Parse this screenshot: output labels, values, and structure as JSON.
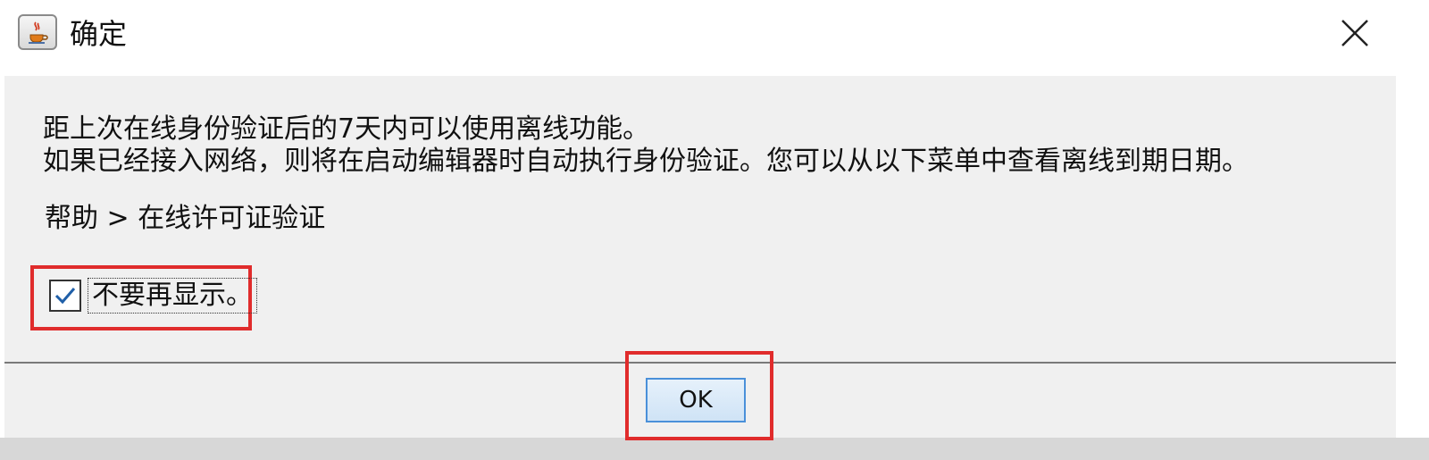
{
  "window": {
    "title": "确定",
    "icon": "java-cup-icon",
    "close_icon": "close-icon"
  },
  "message": {
    "line1": "距上次在线身份验证后的7天内可以使用离线功能。",
    "line2": "如果已经接入网络，则将在启动编辑器时自动执行身份验证。您可以从以下菜单中查看离线到期日期。"
  },
  "menu_path": "帮助 > 在线许可证验证",
  "checkbox": {
    "label": "不要再显示。",
    "checked": true
  },
  "buttons": {
    "ok_label": "OK"
  },
  "colors": {
    "highlight": "#e02c2c",
    "button_border": "#4a90d9"
  }
}
